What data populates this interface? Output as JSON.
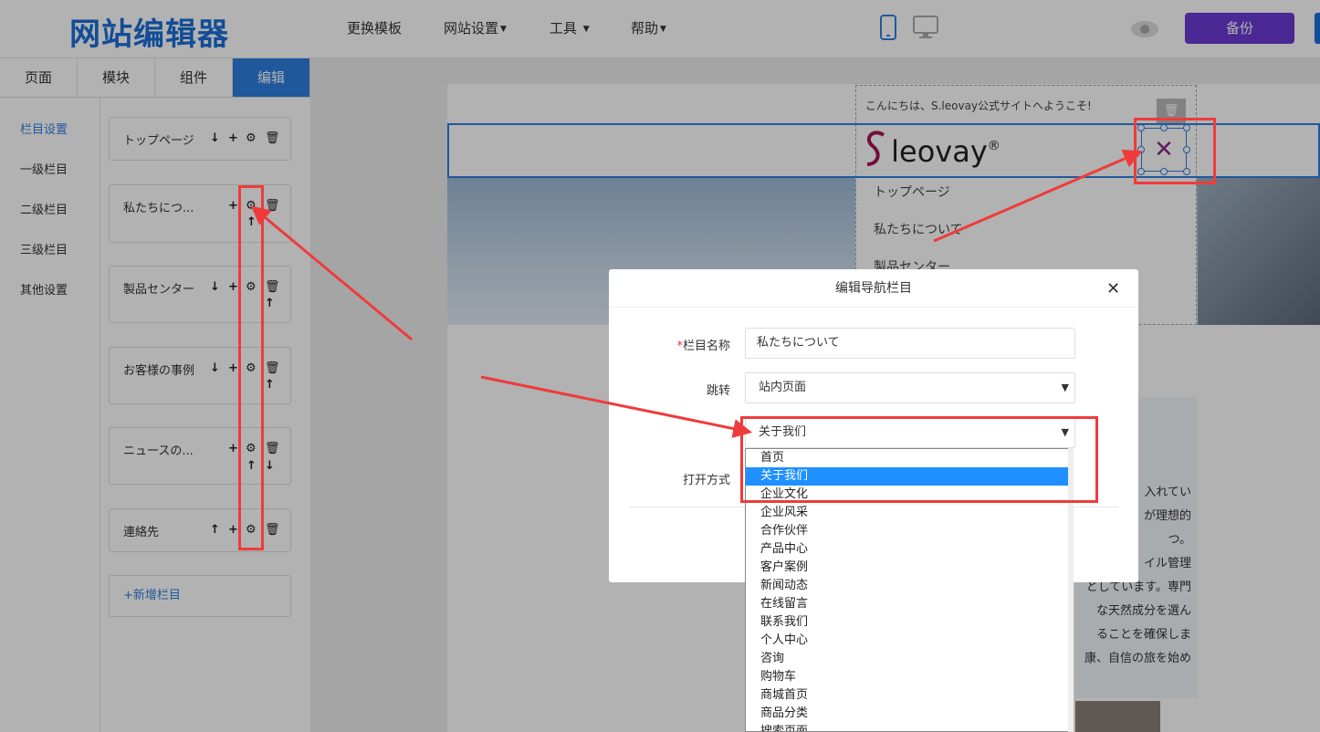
{
  "header": {
    "logo": "网站编辑器",
    "nav": [
      {
        "label": "更换模板"
      },
      {
        "label": "网站设置"
      },
      {
        "label": "工具"
      },
      {
        "label": "帮助"
      }
    ],
    "backup_label": "备份"
  },
  "tabs": [
    "页面",
    "模块",
    "组件",
    "编辑"
  ],
  "sidenav": [
    "栏目设置",
    "一级栏目",
    "二级栏目",
    "三级栏目",
    "其他设置"
  ],
  "columns": [
    {
      "name": "トップページ"
    },
    {
      "name": "私たちにつ..."
    },
    {
      "name": "製品センター"
    },
    {
      "name": "お客様の事例"
    },
    {
      "name": "ニュースの..."
    },
    {
      "name": "連絡先"
    }
  ],
  "add_column_label": "+新增栏目",
  "preview": {
    "greeting": "こんにちは、S.leovay公式サイトへようこそ!",
    "logo_text": "leovay",
    "logo_mark": "®",
    "menu_items": [
      "トップページ",
      "私たちについて",
      "製品センター"
    ],
    "text_lines": [
      "入れてい",
      "が理想的",
      "つ。",
      "イル管理",
      "としています。専門",
      "な天然成分を選ん",
      "ることを確保しま",
      "康、自信の旅を始め"
    ]
  },
  "modal": {
    "title": "编辑导航栏目",
    "name_label": "栏目名称",
    "name_value": "私たちについて",
    "jump_label": "跳转",
    "jump_value": "站内页面",
    "page_value": "关于我们",
    "open_label": "打开方式",
    "options": [
      "首页",
      "关于我们",
      "企业文化",
      "企业风采",
      "合作伙伴",
      "产品中心",
      "客户案例",
      "新闻动态",
      "在线留言",
      "联系我们",
      "个人中心",
      "咨询",
      "购物车",
      "商城首页",
      "商品分类",
      "搜索页面"
    ],
    "highlighted_option": "关于我们"
  },
  "colors": {
    "accent": "#2f7fe0",
    "brand": "#1a6fd8",
    "backup": "#6a3bd4",
    "highlight": "#1e90ff",
    "annotation": "#ef3b3b"
  }
}
